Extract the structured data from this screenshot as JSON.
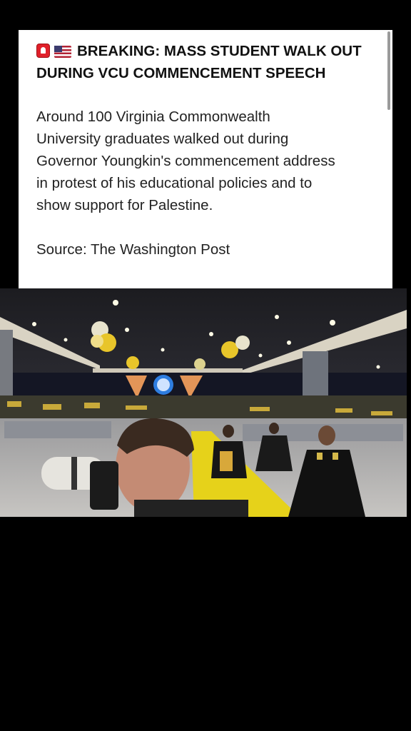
{
  "post": {
    "headline": "BREAKING: MASS STUDENT WALK OUT DURING VCU COMMENCEMENT SPEECH",
    "emoji": [
      "siren-emoji-icon",
      "us-flag-emoji-icon"
    ],
    "body": "Around 100 Virginia Commonwealth\nUniversity graduates walked out during\nGovernor Youngkin's commencement address\nin protest of his educational policies and to\nshow support for Palestine.",
    "source": "Source: The Washington Post"
  },
  "colors": {
    "background": "#000000",
    "card": "#ffffff",
    "aisle_carpet": "#e6d21a",
    "balloons": "#e8c52a"
  }
}
